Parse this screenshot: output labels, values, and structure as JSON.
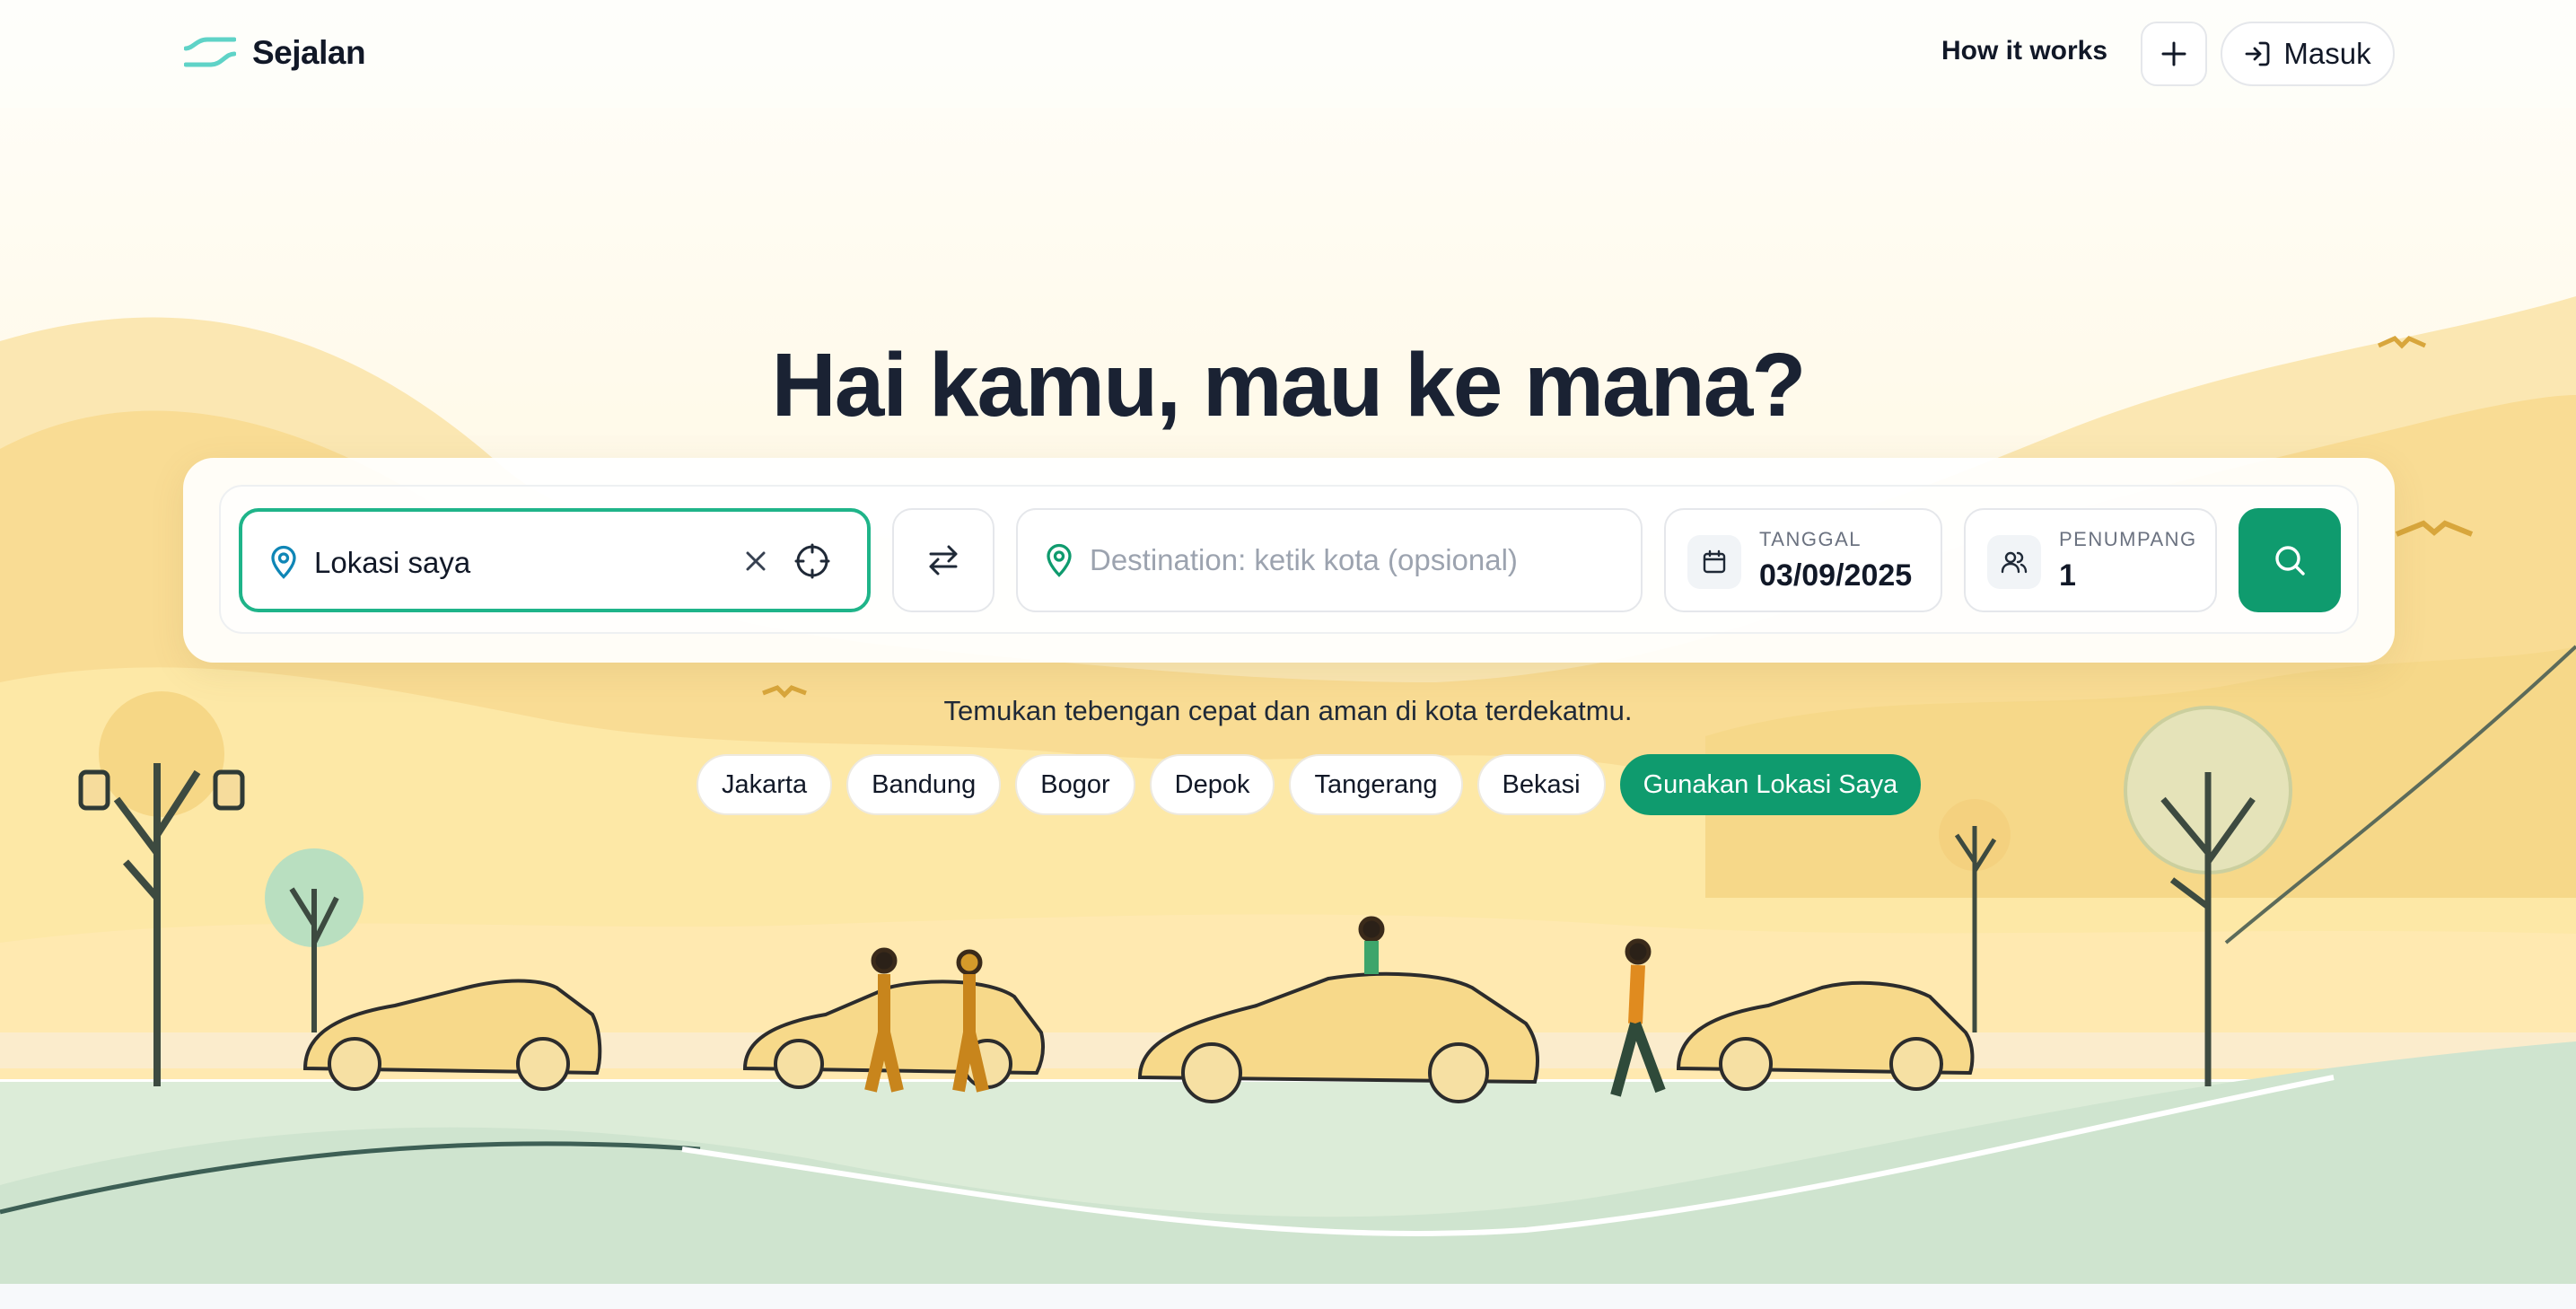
{
  "brand": {
    "name": "Sejalan",
    "logo_icon": "sejalan-wave-logo-icon",
    "accent_color": "#5fd3c7"
  },
  "nav": {
    "how_it_works": "How it works",
    "add_icon": "plus-icon",
    "login_label": "Masuk",
    "login_icon": "login-icon"
  },
  "hero": {
    "title": "Hai kamu, mau ke mana?"
  },
  "search": {
    "origin": {
      "value": "Lokasi saya",
      "icon": "map-pin-icon",
      "clear_icon": "close-icon",
      "locate_icon": "crosshair-icon"
    },
    "swap_icon": "swap-arrows-icon",
    "destination": {
      "placeholder": "Destination: ketik kota (opsional)",
      "value": "",
      "icon": "map-pin-icon"
    },
    "date": {
      "label": "TANGGAL",
      "value": "03/09/2025",
      "icon": "calendar-icon"
    },
    "passengers": {
      "label": "PENUMPANG",
      "value": "1",
      "icon": "users-icon"
    },
    "submit_icon": "search-icon",
    "primary_color": "#0f9b6e"
  },
  "tagline": "Temukan tebengan cepat dan aman di kota terdekatmu.",
  "cities": [
    "Jakarta",
    "Bandung",
    "Bogor",
    "Depok",
    "Tangerang",
    "Bekasi"
  ],
  "use_location_label": "Gunakan Lokasi Saya"
}
